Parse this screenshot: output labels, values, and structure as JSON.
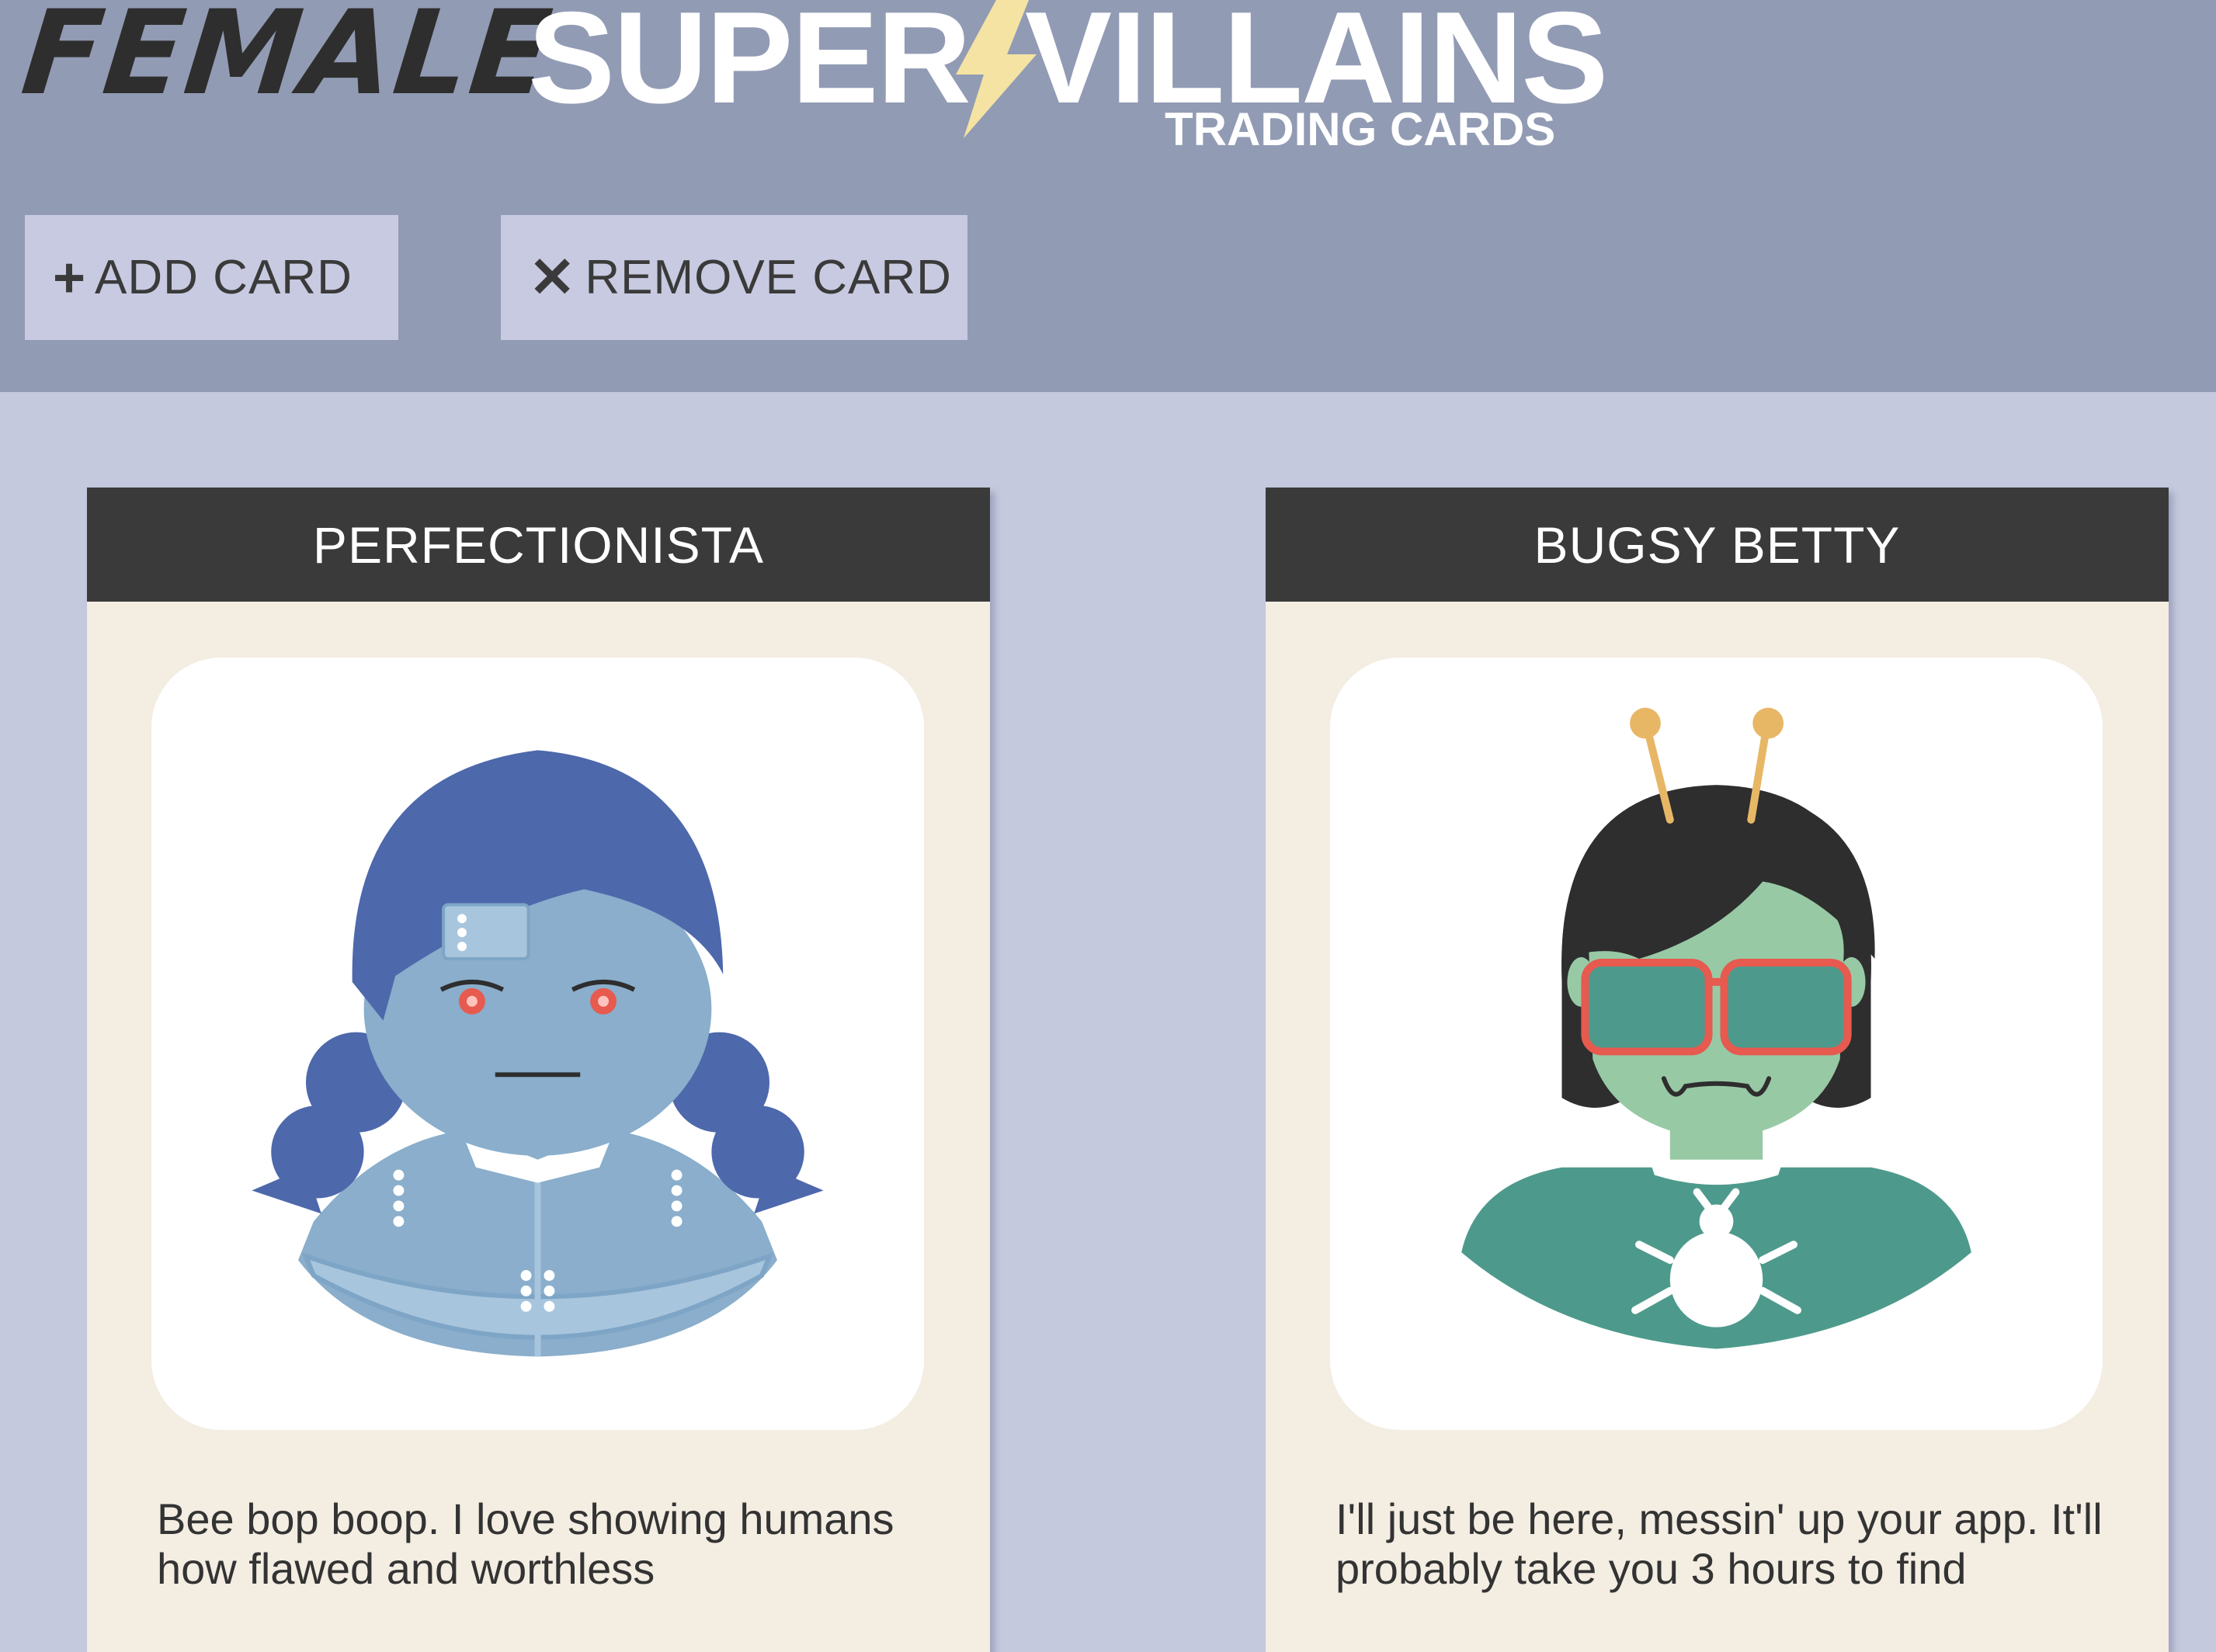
{
  "header": {
    "logo_word_1": "FEMALE",
    "logo_word_2": "SUPER",
    "logo_word_3": "VILLAINS",
    "logo_subtitle": "TRADING CARDS",
    "add_icon": "+",
    "add_label": "ADD CARD",
    "remove_icon": "✕",
    "remove_label": "REMOVE CARD"
  },
  "colors": {
    "header_bg": "#929bb4",
    "page_bg": "#c5c9de",
    "button_bg": "#c7cae0",
    "card_title_bg": "#3a3a3a",
    "card_bg": "#f3ede2",
    "bolt": "#f5e3a3"
  },
  "icons": {
    "logo_bolt": "lightning-bolt-icon",
    "add": "plus-icon",
    "remove": "close-icon"
  },
  "cards": [
    {
      "name": "PERFECTIONISTA",
      "portrait": "robot-girl-portrait",
      "quote": "Bee bop boop. I love showing humans how flawed and worthless"
    },
    {
      "name": "BUGSY BETTY",
      "portrait": "bug-girl-portrait",
      "quote": "I'll just be here, messin' up your app. It'll probably take you 3 hours to find"
    }
  ]
}
